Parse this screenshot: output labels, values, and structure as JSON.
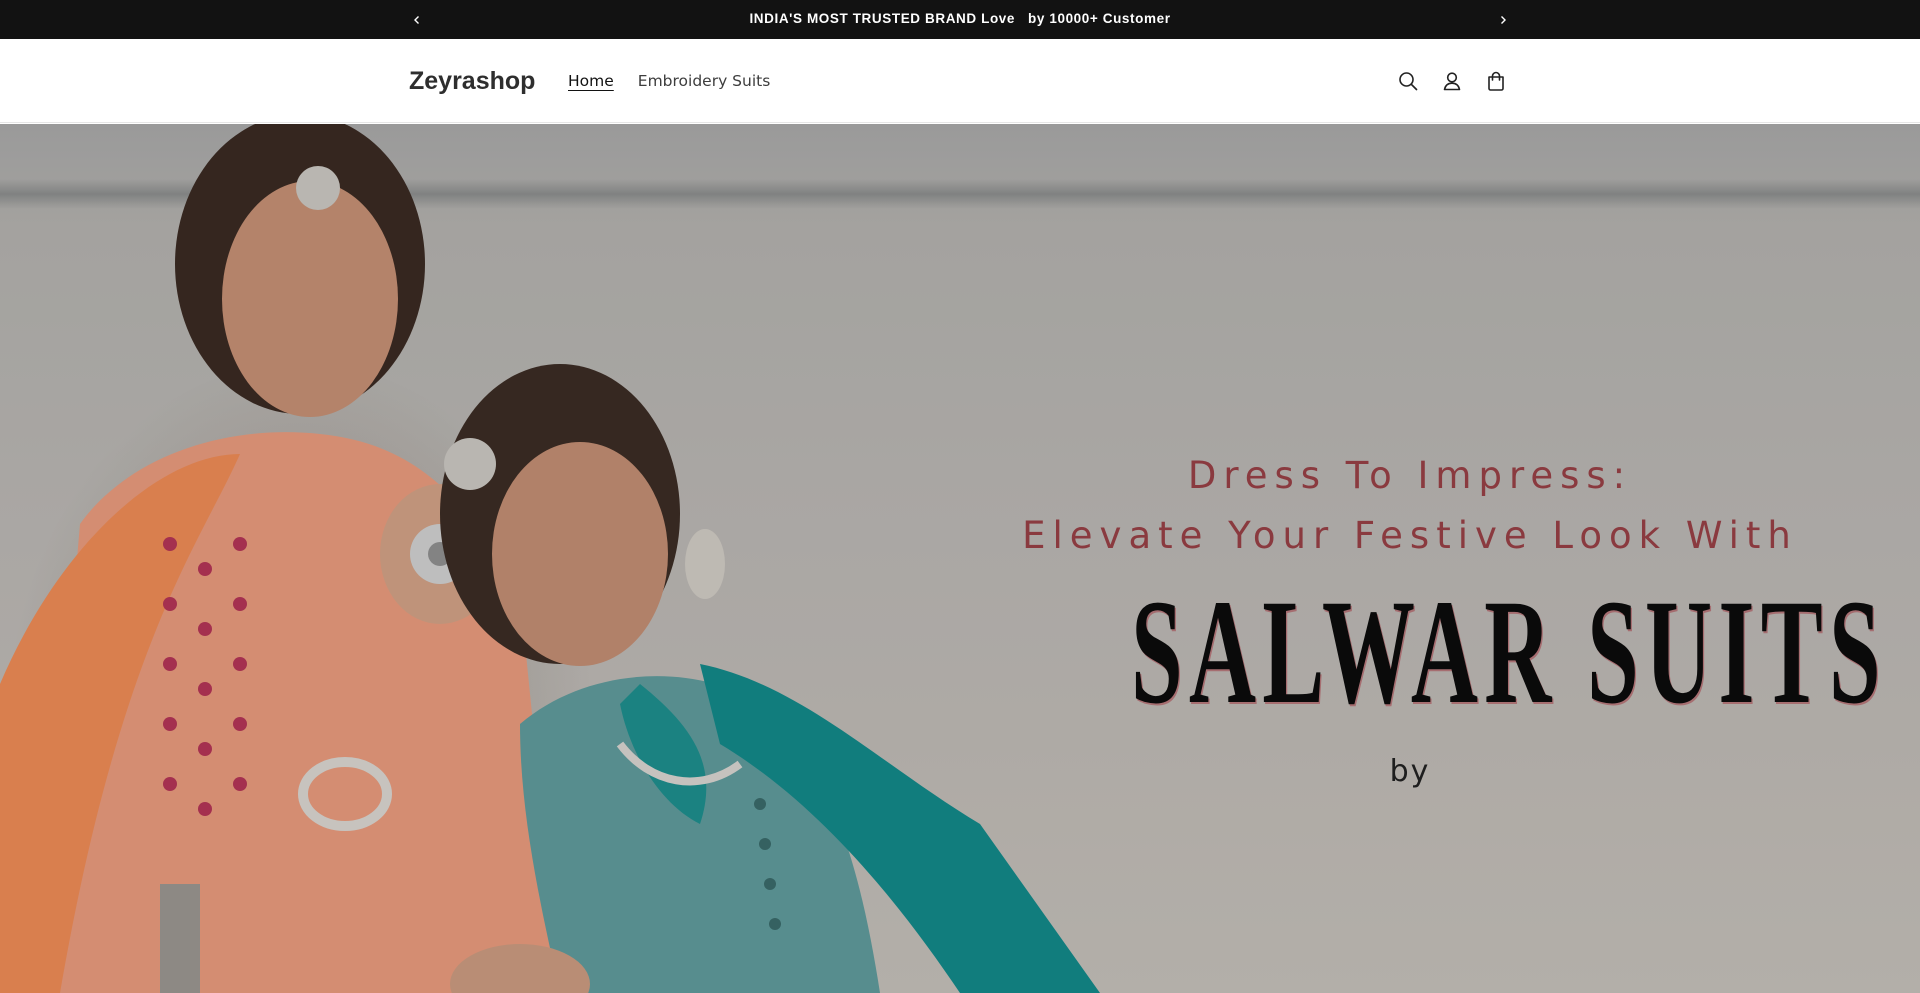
{
  "announcement": {
    "message": "INDIA'S MOST TRUSTED BRAND Love   by 10000+ Customer",
    "prev_icon": "chevron-left-icon",
    "next_icon": "chevron-right-icon"
  },
  "header": {
    "logo": "Zeyrashop",
    "nav": [
      {
        "label": "Home",
        "active": true
      },
      {
        "label": "Embroidery Suits",
        "active": false
      }
    ],
    "icons": [
      "search-icon",
      "account-icon",
      "cart-icon"
    ]
  },
  "hero": {
    "line1": "Dress To Impress:",
    "line2": "Elevate Your Festive Look With",
    "title": "SALWAR SUITS",
    "by": "by",
    "colors": {
      "accent_text": "#8a3a3f",
      "title_text": "#0a0a0a"
    }
  }
}
